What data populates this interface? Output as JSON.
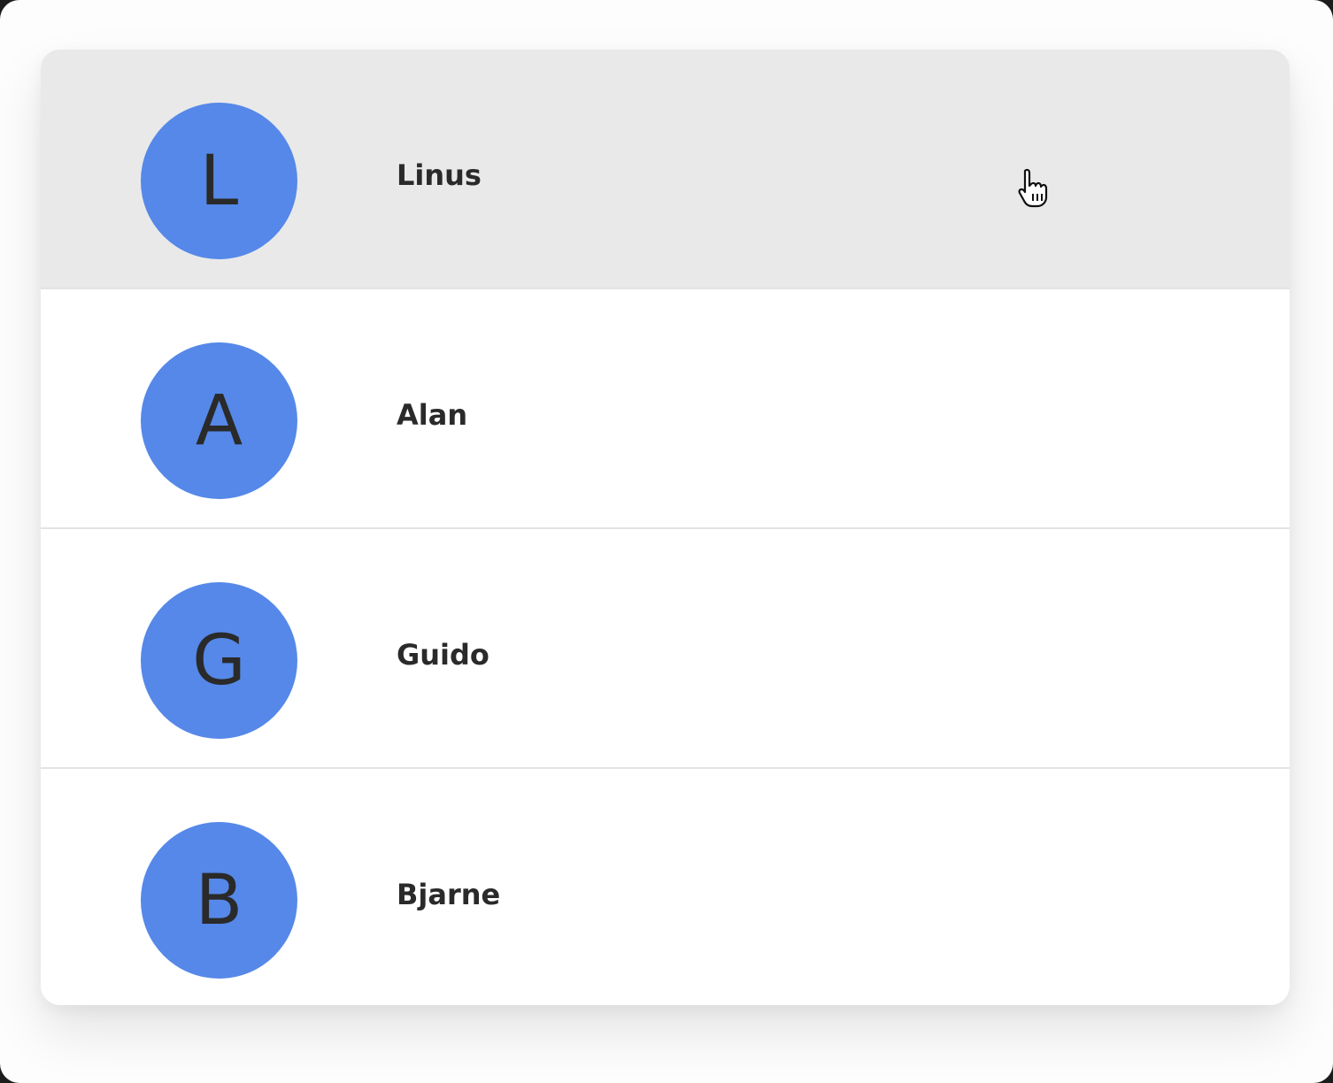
{
  "contacts": [
    {
      "initial": "L",
      "name": "Linus",
      "hovered": true
    },
    {
      "initial": "A",
      "name": "Alan",
      "hovered": false
    },
    {
      "initial": "G",
      "name": "Guido",
      "hovered": false
    },
    {
      "initial": "B",
      "name": "Bjarne",
      "hovered": false
    }
  ],
  "colors": {
    "avatar": "#5588e8",
    "hover_row": "#e9e9e9",
    "text": "#2a2a2a",
    "divider": "#e3e3e3"
  },
  "cursor": {
    "type": "pointer-hand-icon"
  }
}
